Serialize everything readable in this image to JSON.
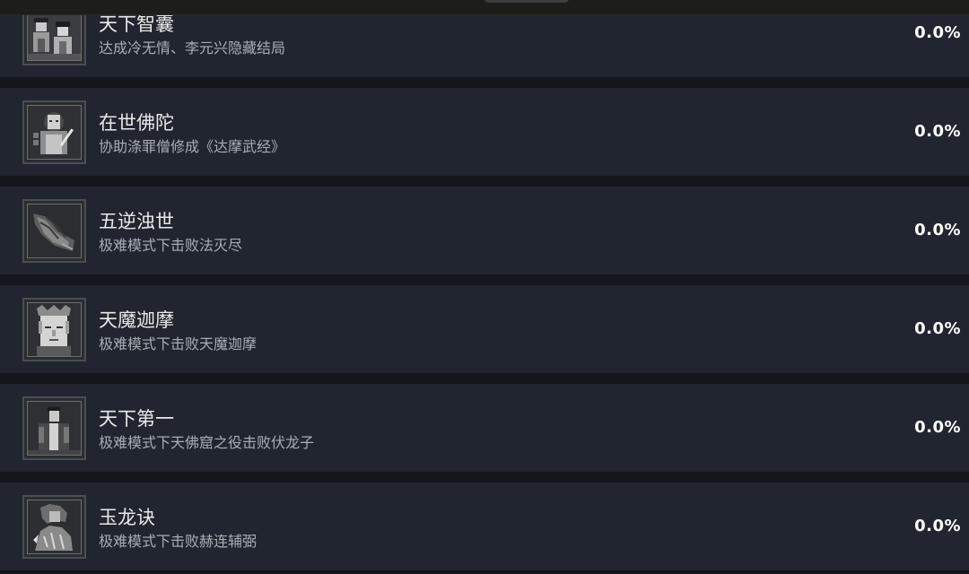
{
  "achievements": [
    {
      "title": "天下智囊",
      "desc": "达成冷无情、李元兴隐藏结局",
      "pct": "0.0%",
      "icon": "two-figures-icon"
    },
    {
      "title": "在世佛陀",
      "desc": "协助涤罪僧修成《达摩武经》",
      "pct": "0.0%",
      "icon": "monk-icon"
    },
    {
      "title": "五逆浊世",
      "desc": "极难模式下击败法灭尽",
      "pct": "0.0%",
      "icon": "claw-icon"
    },
    {
      "title": "天魔迦摩",
      "desc": "极难模式下击败天魔迦摩",
      "pct": "0.0%",
      "icon": "demon-face-icon"
    },
    {
      "title": "天下第一",
      "desc": "极难模式下天佛窟之役击败伏龙子",
      "pct": "0.0%",
      "icon": "swordsman-icon"
    },
    {
      "title": "玉龙诀",
      "desc": "极难模式下击败赫连辅弼",
      "pct": "0.0%",
      "icon": "dragon-warrior-icon"
    }
  ]
}
